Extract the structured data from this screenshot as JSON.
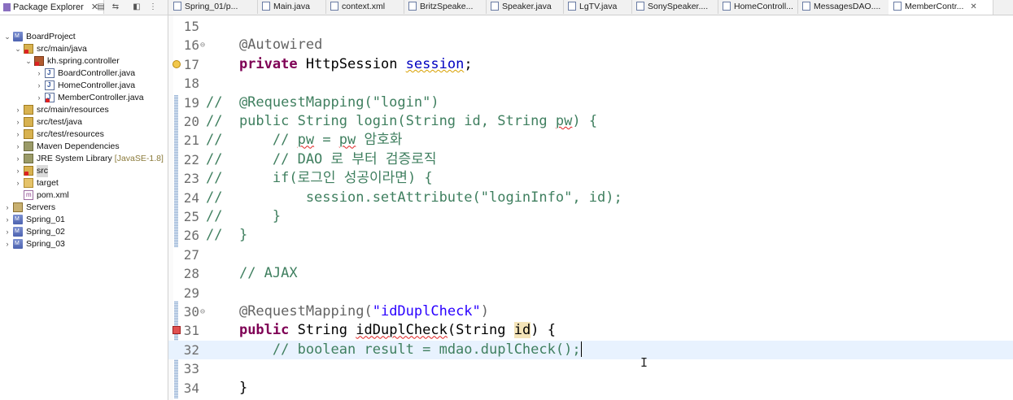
{
  "explorer": {
    "title": "Package Explorer",
    "tree": [
      {
        "label": "BoardProject",
        "depth": 0,
        "arrow": "open",
        "icon": "proj",
        "name": "tree-item-boardproject",
        "sel": false,
        "err": false
      },
      {
        "label": "src/main/java",
        "depth": 1,
        "arrow": "open",
        "icon": "srcfolder",
        "name": "tree-item-src-main-java",
        "sel": false,
        "err": true
      },
      {
        "label": "kh.spring.controller",
        "depth": 2,
        "arrow": "open",
        "icon": "pkg",
        "name": "tree-item-package",
        "sel": false,
        "err": true
      },
      {
        "label": "BoardController.java",
        "depth": 3,
        "arrow": "closed",
        "icon": "java",
        "name": "tree-item-boardcontroller",
        "sel": false,
        "err": false
      },
      {
        "label": "HomeController.java",
        "depth": 3,
        "arrow": "closed",
        "icon": "java",
        "name": "tree-item-homecontroller",
        "sel": false,
        "err": false
      },
      {
        "label": "MemberController.java",
        "depth": 3,
        "arrow": "closed",
        "icon": "java",
        "name": "tree-item-membercontroller",
        "sel": false,
        "err": true
      },
      {
        "label": "src/main/resources",
        "depth": 1,
        "arrow": "closed",
        "icon": "srcfolder",
        "name": "tree-item-src-main-resources",
        "sel": false,
        "err": false
      },
      {
        "label": "src/test/java",
        "depth": 1,
        "arrow": "closed",
        "icon": "srcfolder",
        "name": "tree-item-src-test-java",
        "sel": false,
        "err": false
      },
      {
        "label": "src/test/resources",
        "depth": 1,
        "arrow": "closed",
        "icon": "srcfolder",
        "name": "tree-item-src-test-resources",
        "sel": false,
        "err": false
      },
      {
        "label": "Maven Dependencies",
        "depth": 1,
        "arrow": "closed",
        "icon": "lib",
        "name": "tree-item-maven-dependencies",
        "sel": false,
        "err": false
      },
      {
        "label": "JRE System Library",
        "deco": "[JavaSE-1.8]",
        "depth": 1,
        "arrow": "closed",
        "icon": "lib",
        "name": "tree-item-jre-library",
        "sel": false,
        "err": false
      },
      {
        "label": "src",
        "depth": 1,
        "arrow": "closed",
        "icon": "srcfolder",
        "name": "tree-item-src",
        "sel": true,
        "err": true
      },
      {
        "label": "target",
        "depth": 1,
        "arrow": "closed",
        "icon": "folder",
        "name": "tree-item-target",
        "sel": false,
        "err": false
      },
      {
        "label": "pom.xml",
        "depth": 1,
        "arrow": "none",
        "icon": "xml",
        "name": "tree-item-pom",
        "sel": false,
        "err": false
      },
      {
        "label": "Servers",
        "depth": 0,
        "arrow": "closed",
        "icon": "server",
        "name": "tree-item-servers",
        "sel": false,
        "err": false
      },
      {
        "label": "Spring_01",
        "depth": 0,
        "arrow": "closed",
        "icon": "proj",
        "name": "tree-item-spring01",
        "sel": false,
        "err": false
      },
      {
        "label": "Spring_02",
        "depth": 0,
        "arrow": "closed",
        "icon": "proj",
        "name": "tree-item-spring02",
        "sel": false,
        "err": false
      },
      {
        "label": "Spring_03",
        "depth": 0,
        "arrow": "closed",
        "icon": "proj",
        "name": "tree-item-spring03",
        "sel": false,
        "err": false
      }
    ]
  },
  "tabs": [
    {
      "label": "Spring_01/p...",
      "active": false
    },
    {
      "label": "Main.java",
      "active": false
    },
    {
      "label": "context.xml",
      "active": false
    },
    {
      "label": "BritzSpeake...",
      "active": false
    },
    {
      "label": "Speaker.java",
      "active": false
    },
    {
      "label": "LgTV.java",
      "active": false
    },
    {
      "label": "SonySpeaker....",
      "active": false
    },
    {
      "label": "HomeControll...",
      "active": false
    },
    {
      "label": "MessagesDAO....",
      "active": false
    },
    {
      "label": "MemberContr...",
      "active": true
    }
  ],
  "editor": {
    "current_line": 32,
    "lines": [
      {
        "n": "15",
        "fold": false,
        "marker": "",
        "tokens": []
      },
      {
        "n": "16",
        "fold": true,
        "marker": "",
        "tokens": [
          {
            "t": "    ",
            "c": "plain"
          },
          {
            "t": "@Autowired",
            "c": "ann"
          }
        ]
      },
      {
        "n": "17",
        "fold": false,
        "marker": "warn",
        "tokens": [
          {
            "t": "    ",
            "c": "plain"
          },
          {
            "t": "private",
            "c": "kw"
          },
          {
            "t": " HttpSession ",
            "c": "plain"
          },
          {
            "t": "session",
            "c": "fld warnU"
          },
          {
            "t": ";",
            "c": "plain"
          }
        ]
      },
      {
        "n": "18",
        "fold": false,
        "marker": "",
        "tokens": []
      },
      {
        "n": "19",
        "fold": false,
        "marker": "",
        "tokens": [
          {
            "t": "//  @RequestMapping(\"login\")",
            "c": "cmt"
          }
        ]
      },
      {
        "n": "20",
        "fold": false,
        "marker": "",
        "tokens": [
          {
            "t": "//  public String login(String id, String ",
            "c": "cmt"
          },
          {
            "t": "pw",
            "c": "cmt errU"
          },
          {
            "t": ") {",
            "c": "cmt"
          }
        ]
      },
      {
        "n": "21",
        "fold": false,
        "marker": "",
        "tokens": [
          {
            "t": "//      // ",
            "c": "cmt"
          },
          {
            "t": "pw",
            "c": "cmt errU"
          },
          {
            "t": " = ",
            "c": "cmt"
          },
          {
            "t": "pw",
            "c": "cmt errU"
          },
          {
            "t": " 암호화",
            "c": "cmt"
          }
        ]
      },
      {
        "n": "22",
        "fold": false,
        "marker": "",
        "tokens": [
          {
            "t": "//      // DAO 로 부터 검증로직",
            "c": "cmt"
          }
        ]
      },
      {
        "n": "23",
        "fold": false,
        "marker": "",
        "tokens": [
          {
            "t": "//      if(로그인 성공이라면) {",
            "c": "cmt"
          }
        ]
      },
      {
        "n": "24",
        "fold": false,
        "marker": "",
        "tokens": [
          {
            "t": "//          session.setAttribute(\"loginInfo\", id);",
            "c": "cmt"
          }
        ]
      },
      {
        "n": "25",
        "fold": false,
        "marker": "",
        "tokens": [
          {
            "t": "//      }",
            "c": "cmt"
          }
        ]
      },
      {
        "n": "26",
        "fold": false,
        "marker": "",
        "tokens": [
          {
            "t": "//  }",
            "c": "cmt"
          }
        ]
      },
      {
        "n": "27",
        "fold": false,
        "marker": "",
        "tokens": []
      },
      {
        "n": "28",
        "fold": false,
        "marker": "",
        "tokens": [
          {
            "t": "    ",
            "c": "plain"
          },
          {
            "t": "// AJAX",
            "c": "cmt"
          }
        ]
      },
      {
        "n": "29",
        "fold": false,
        "marker": "",
        "tokens": []
      },
      {
        "n": "30",
        "fold": true,
        "marker": "",
        "tokens": [
          {
            "t": "    ",
            "c": "plain"
          },
          {
            "t": "@RequestMapping(",
            "c": "ann"
          },
          {
            "t": "\"idDuplCheck\"",
            "c": "str"
          },
          {
            "t": ")",
            "c": "ann"
          }
        ]
      },
      {
        "n": "31",
        "fold": false,
        "marker": "err",
        "tokens": [
          {
            "t": "    ",
            "c": "plain"
          },
          {
            "t": "public",
            "c": "kw"
          },
          {
            "t": " String ",
            "c": "plain"
          },
          {
            "t": "idDuplCheck",
            "c": "plain errU"
          },
          {
            "t": "(String ",
            "c": "plain"
          },
          {
            "t": "id",
            "c": "plain hl"
          },
          {
            "t": ") {",
            "c": "plain"
          }
        ]
      },
      {
        "n": "32",
        "fold": false,
        "marker": "",
        "tokens": [
          {
            "t": "        ",
            "c": "plain"
          },
          {
            "t": "// boolean result = mdao.duplCheck();",
            "c": "cmt"
          }
        ],
        "caret": true
      },
      {
        "n": "33",
        "fold": false,
        "marker": "",
        "tokens": []
      },
      {
        "n": "34",
        "fold": false,
        "marker": "",
        "tokens": [
          {
            "t": "    }",
            "c": "plain"
          }
        ]
      }
    ]
  }
}
